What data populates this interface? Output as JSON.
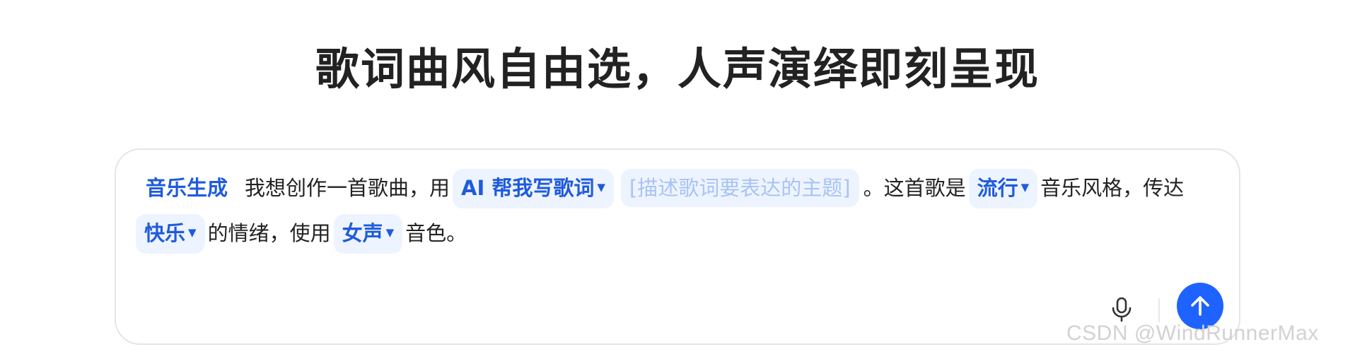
{
  "page_title": "歌词曲风自由选，人声演绎即刻呈现",
  "composer": {
    "mode_tag": "音乐生成",
    "text_1": "我想创作一首歌曲，用",
    "chip_lyrics": "AI 帮我写歌词",
    "slot_theme": "[描述歌词要表达的主题]",
    "text_2": "。这首歌是",
    "chip_genre": "流行",
    "text_3": "音乐风格，传达",
    "chip_mood": "快乐",
    "text_4": "的情绪，使用",
    "chip_voice": "女声",
    "text_5": "音色。",
    "caret_glyph": "▼"
  },
  "icons": {
    "mic": "microphone-icon",
    "send": "arrow-up-icon"
  },
  "colors": {
    "accent": "#1F5BDC",
    "chip_bg": "#EEF4FF",
    "send_button": "#1E63FF",
    "placeholder": "#A8C3F5"
  },
  "watermark": "CSDN @WindRunnerMax"
}
